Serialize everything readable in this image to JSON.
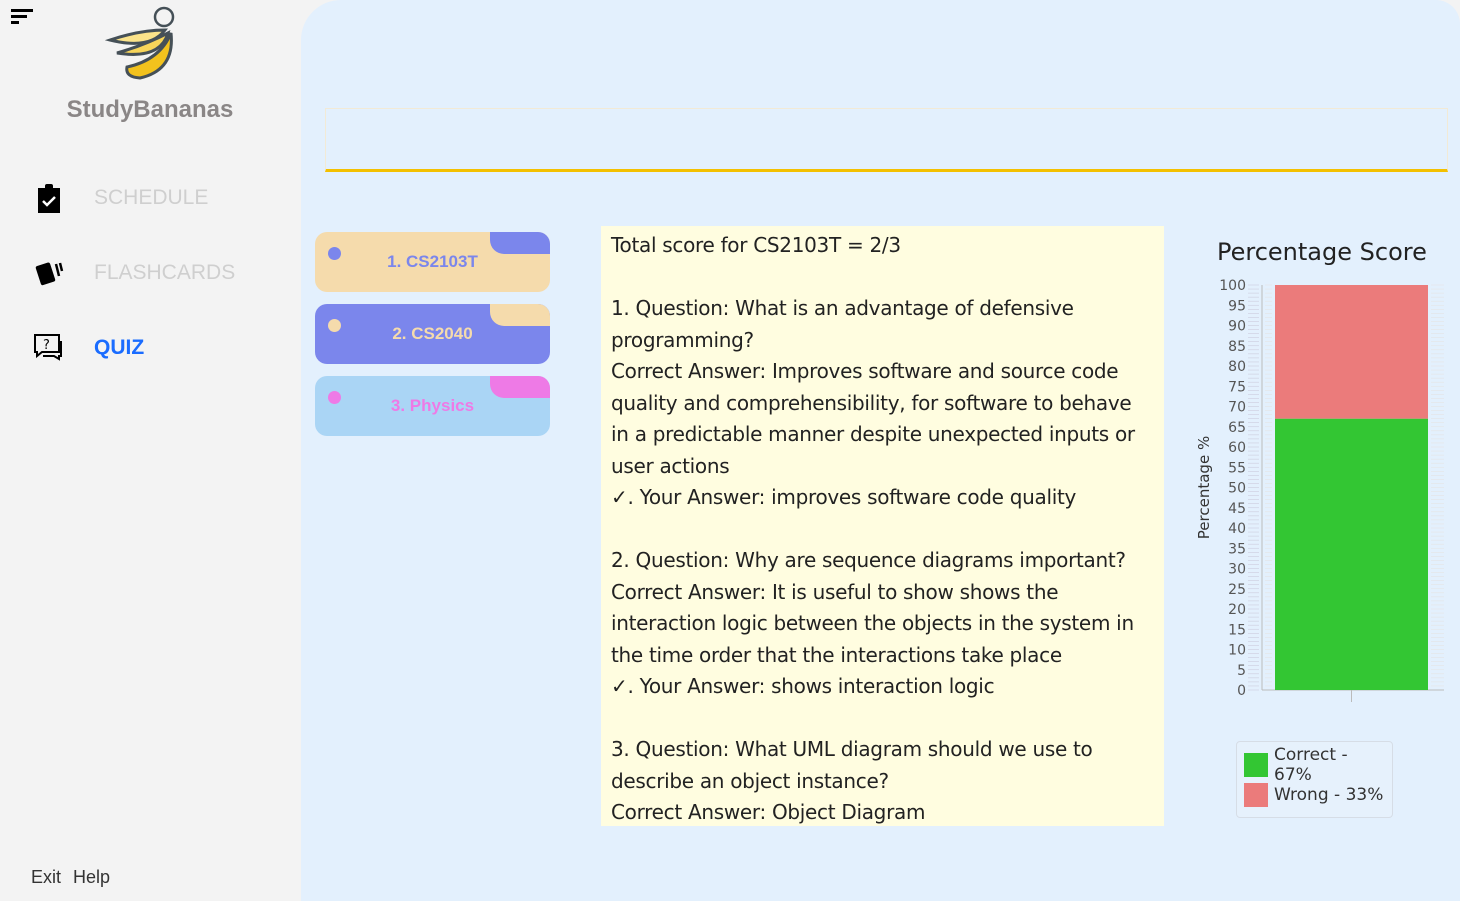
{
  "sidebar": {
    "brand": "StudyBananas",
    "items": [
      {
        "label": "SCHEDULE",
        "icon": "clipboard-check-icon"
      },
      {
        "label": "FLASHCARDS",
        "icon": "cards-icon"
      },
      {
        "label": "QUIZ",
        "icon": "question-chat-icon",
        "active": true
      }
    ],
    "footer": {
      "exit": "Exit",
      "help": "Help"
    }
  },
  "search": {
    "value": ""
  },
  "quizzes": [
    {
      "label": "1. CS2103T",
      "bg": "#f5dbac",
      "accent": "#7b86ec"
    },
    {
      "label": "2. CS2040",
      "bg": "#7b86ec",
      "accent": "#f5dbac"
    },
    {
      "label": "3. Physics",
      "bg": "#aad5f5",
      "accent": "#ee7ae6"
    }
  ],
  "result": {
    "lines": [
      "Total score for CS2103T = 2/3",
      "",
      "1. Question: What is an advantage of defensive programming?",
      "Correct Answer: Improves software and source code quality and comprehensibility, for software to behave in a predictable manner despite unexpected inputs or user actions",
      "✓. Your Answer: improves software code quality",
      "",
      "2. Question: Why are sequence diagrams important?",
      "Correct Answer: It is useful to show shows the interaction logic between the objects in the system in the time order that the interactions take place",
      "✓. Your Answer: shows interaction logic",
      "",
      "3. Question: What UML diagram should we use to describe an object instance?",
      "Correct Answer: Object Diagram"
    ]
  },
  "chart_data": {
    "type": "bar",
    "stacked": true,
    "title": "Percentage Score",
    "ylabel": "Percentage %",
    "xlabel": "",
    "ylim": [
      0,
      100
    ],
    "yticks": [
      0,
      5,
      10,
      15,
      20,
      25,
      30,
      35,
      40,
      45,
      50,
      55,
      60,
      65,
      70,
      75,
      80,
      85,
      90,
      95,
      100
    ],
    "series": [
      {
        "name": "Correct - 67%",
        "values": [
          67
        ],
        "color": "#33c633"
      },
      {
        "name": "Wrong - 33%",
        "values": [
          33
        ],
        "color": "#eb7b7b"
      }
    ],
    "legend": "bottom"
  }
}
